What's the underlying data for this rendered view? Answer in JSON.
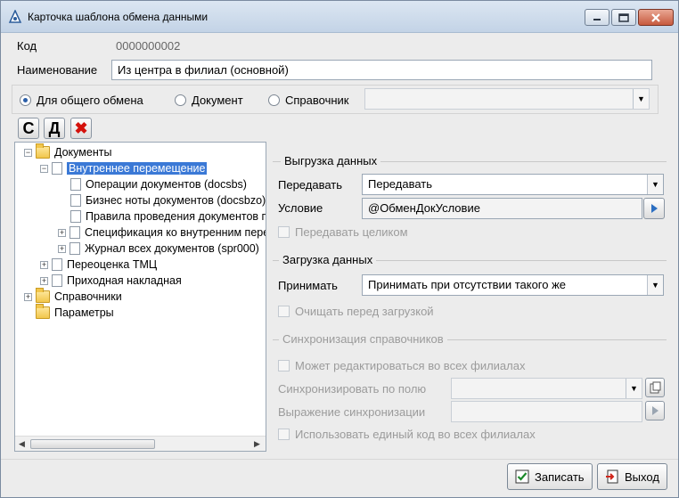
{
  "window": {
    "title": "Карточка шаблона обмена данными",
    "controls": {
      "minimize": "▬",
      "maximize": "▢",
      "close": "✕"
    }
  },
  "form": {
    "code_label": "Код",
    "code_value": "0000000002",
    "name_label": "Наименование",
    "name_value": "Из центра в филиал (основной)"
  },
  "exchange_type": {
    "options": [
      "Для общего обмена",
      "Документ",
      "Справочник"
    ],
    "selected": "Для общего обмена",
    "reference_value": ""
  },
  "toolbar": {
    "c_label": "С",
    "d_label": "Д",
    "delete_icon": "✖"
  },
  "tree": {
    "root_documents": "Документы",
    "internal_move": "Внутреннее перемещение",
    "ops": "Операции документов (docsbs)",
    "notes": "Бизнес ноты документов (docsbzo)",
    "rules": "Правила проведения документов п",
    "spec": "Спецификация ко внутренним пере",
    "journal": "Журнал всех документов (spr000)",
    "revaluation": "Переоценка ТМЦ",
    "incoming": "Приходная накладная",
    "references": "Справочники",
    "params": "Параметры"
  },
  "upload": {
    "title": "Выгрузка данных",
    "transfer_label": "Передавать",
    "transfer_value": "Передавать",
    "condition_label": "Условие",
    "condition_value": "@ОбменДокУсловие",
    "whole_label": "Передавать целиком"
  },
  "download": {
    "title": "Загрузка данных",
    "accept_label": "Принимать",
    "accept_value": "Принимать при отсутствии такого же",
    "clear_label": "Очищать перед загрузкой"
  },
  "sync": {
    "title": "Синхронизация справочников",
    "editable_label": "Может редактироваться во всех филиалах",
    "field_label": "Синхронизировать по полю",
    "field_value": "",
    "expr_label": "Выражение синхронизации",
    "expr_value": "",
    "single_code_label": "Использовать единый код во всех филиалах"
  },
  "buttons": {
    "save": "Записать",
    "exit": "Выход"
  },
  "colors": {
    "titlebar": "#c3d3e6",
    "selection": "#3b79d6",
    "close_button": "#c75a3f"
  }
}
